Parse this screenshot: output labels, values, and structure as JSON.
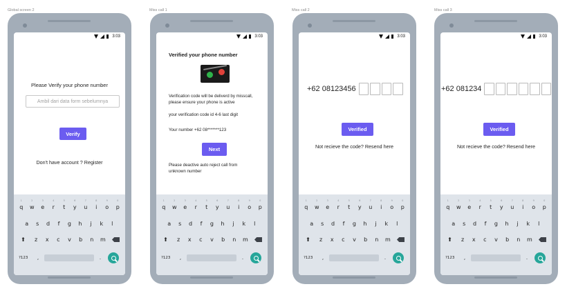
{
  "labels": {
    "screen1": "Global screen 2",
    "screen2": "Miss call 1",
    "screen3": "Miss call 2",
    "screen4": "Miss call 3"
  },
  "status_bar": {
    "time": "3:03"
  },
  "screen1": {
    "title": "Please Verify your phone number",
    "input_placeholder": "Ambil dari data form sebelumnya",
    "verify_button": "Verify",
    "register_text": "Don't have account ? Register"
  },
  "screen2": {
    "title": "Verified your phone number",
    "body_line1": "Verification code will be deliverd by misscall,",
    "body_line2": "please ensure your phone is active",
    "code_hint": "your verification code id 4-6 last digit",
    "your_number": "Your number +62 08*******123",
    "next_button": "Next",
    "warning_line1": "Please deactive auto reject call from",
    "warning_line2": "unknown number"
  },
  "screen3": {
    "prefix": "+62 08123456",
    "otp_boxes": 4,
    "verified_button": "Verified",
    "resend_text": "Not recieve the code? Resend here"
  },
  "screen4": {
    "prefix": "+62 081234",
    "otp_boxes": 6,
    "verified_button": "Verified",
    "resend_text": "Not recieve the code? Resend here"
  },
  "keyboard": {
    "row1": [
      "q",
      "w",
      "e",
      "r",
      "t",
      "y",
      "u",
      "i",
      "o",
      "p"
    ],
    "row1_nums": [
      "1",
      "2",
      "3",
      "4",
      "5",
      "6",
      "7",
      "8",
      "9",
      "0"
    ],
    "row2": [
      "a",
      "s",
      "d",
      "f",
      "g",
      "h",
      "j",
      "k",
      "l"
    ],
    "row3": [
      "z",
      "x",
      "c",
      "v",
      "b",
      "n",
      "m"
    ],
    "symbols_label": "?123",
    "comma": ",",
    "dot": "."
  },
  "colors": {
    "accent": "#6b5cf0",
    "phone_body": "#a3adb8",
    "keyboard_bg": "#dfe4ea",
    "search_key": "#26a69a"
  },
  "icons": [
    "wifi-icon",
    "signal-icon",
    "battery-icon",
    "shift-icon",
    "backspace-icon",
    "search-icon",
    "camera-icon"
  ]
}
